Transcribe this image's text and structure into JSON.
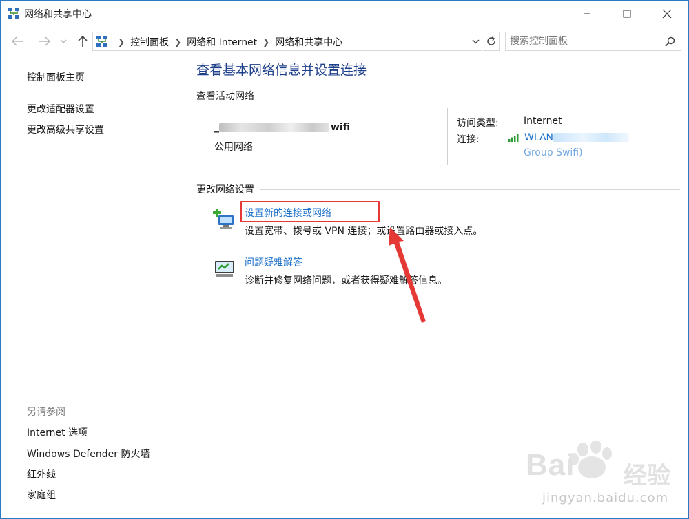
{
  "window": {
    "title": "网络和共享中心"
  },
  "nav": {
    "breadcrumbs": [
      "控制面板",
      "网络和 Internet",
      "网络和共享中心"
    ],
    "search_placeholder": "搜索控制面板"
  },
  "sidebar": {
    "home": "控制面板主页",
    "links": [
      "更改适配器设置",
      "更改高级共享设置"
    ],
    "see_also_heading": "另请参阅",
    "see_also": [
      "Internet 选项",
      "Windows Defender 防火墙",
      "红外线",
      "家庭组"
    ]
  },
  "main": {
    "title": "查看基本网络信息并设置连接",
    "active_section": "查看活动网络",
    "network_name_prefix": "_",
    "network_name_suffix": "wifi",
    "network_type": "公用网络",
    "access_type_label": "访问类型:",
    "access_type_value": "Internet",
    "connection_label": "连接:",
    "connection_value_prefix": "WLAN",
    "connection_value_line2": "Group  Swifi)",
    "change_section": "更改网络设置",
    "tasks": [
      {
        "link": "设置新的连接或网络",
        "desc": "设置宽带、拨号或 VPN 连接；或设置路由器或接入点。"
      },
      {
        "link": "问题疑难解答",
        "desc": "诊断并修复网络问题，或者获得疑难解答信息。"
      }
    ]
  },
  "watermark": {
    "brand": "Bai",
    "brand_cn": "经验",
    "url": "jingyan.baidu.com"
  },
  "colors": {
    "link": "#1a6fc9",
    "title": "#1e3f8a",
    "highlight": "#e53935"
  }
}
